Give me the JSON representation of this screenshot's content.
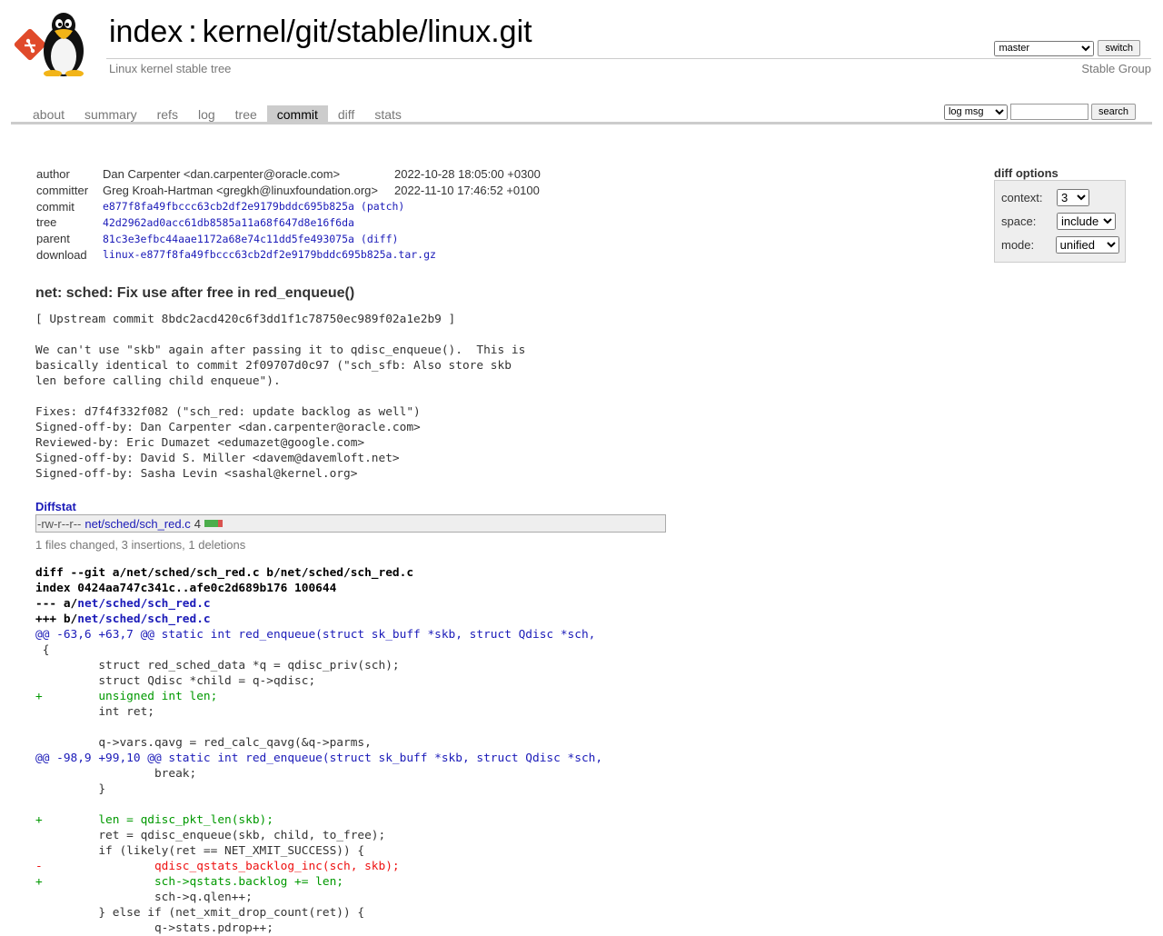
{
  "header": {
    "title_index": "index",
    "title_sep": ":",
    "title_repo": "kernel/git/stable/linux.git",
    "description": "Linux kernel stable tree",
    "owner": "Stable Group",
    "branch_selected": "master",
    "switch_label": "switch"
  },
  "tabs": [
    {
      "label": "about"
    },
    {
      "label": "summary"
    },
    {
      "label": "refs"
    },
    {
      "label": "log"
    },
    {
      "label": "tree"
    },
    {
      "label": "commit",
      "active": true
    },
    {
      "label": "diff"
    },
    {
      "label": "stats"
    }
  ],
  "search": {
    "mode_selected": "log msg",
    "query": "",
    "button_label": "search"
  },
  "diff_options": {
    "title": "diff options",
    "context_label": "context:",
    "context_value": "3",
    "space_label": "space:",
    "space_value": "include",
    "mode_label": "mode:",
    "mode_value": "unified"
  },
  "commit_info": {
    "author_label": "author",
    "author": "Dan Carpenter <dan.carpenter@oracle.com>",
    "author_date": "2022-10-28 18:05:00 +0300",
    "committer_label": "committer",
    "committer": "Greg Kroah-Hartman <gregkh@linuxfoundation.org>",
    "committer_date": "2022-11-10 17:46:52 +0100",
    "commit_label": "commit",
    "commit_hash": "e877f8fa49fbccc63cb2df2e9179bddc695b825a",
    "commit_link": "(patch)",
    "tree_label": "tree",
    "tree_hash": "42d2962ad0acc61db8585a11a68f647d8e16f6da",
    "parent_label": "parent",
    "parent_hash": "81c3e3efbc44aae1172a68e74c11dd5fe493075a",
    "parent_link": "(diff)",
    "download_label": "download",
    "download_file": "linux-e877f8fa49fbccc63cb2df2e9179bddc695b825a.tar.gz"
  },
  "commit": {
    "subject": "net: sched: Fix use after free in red_enqueue()",
    "message": "[ Upstream commit 8bdc2acd420c6f3dd1f1c78750ec989f02a1e2b9 ]\n\nWe can't use \"skb\" again after passing it to qdisc_enqueue().  This is\nbasically identical to commit 2f09707d0c97 (\"sch_sfb: Also store skb\nlen before calling child enqueue\").\n\nFixes: d7f4f332f082 (\"sch_red: update backlog as well\")\nSigned-off-by: Dan Carpenter <dan.carpenter@oracle.com>\nReviewed-by: Eric Dumazet <edumazet@google.com>\nSigned-off-by: David S. Miller <davem@davemloft.net>\nSigned-off-by: Sasha Levin <sashal@kernel.org>"
  },
  "diffstat": {
    "header": "Diffstat",
    "mode": "-rw-r--r--",
    "file": "net/sched/sch_red.c",
    "changes": "4",
    "insertions": 3,
    "deletions": 1,
    "summary": "1 files changed, 3 insertions, 1 deletions"
  },
  "diff": {
    "git_line_prefix": "diff --git a/net/sched/sch_red.c b/net/sched/sch_red.c",
    "index_line": "index 0424aa747c341c..afe0c2d689b176 100644",
    "old_prefix": "--- a/",
    "new_prefix": "+++ b/",
    "path": "net/sched/sch_red.c",
    "lines": [
      {
        "t": "hunk",
        "text": "@@ -63,6 +63,7 @@ static int red_enqueue(struct sk_buff *skb, struct Qdisc *sch,"
      },
      {
        "t": "ctx",
        "text": " {"
      },
      {
        "t": "ctx",
        "text": " \tstruct red_sched_data *q = qdisc_priv(sch);"
      },
      {
        "t": "ctx",
        "text": " \tstruct Qdisc *child = q->qdisc;"
      },
      {
        "t": "add",
        "text": "+\tunsigned int len;"
      },
      {
        "t": "ctx",
        "text": " \tint ret;"
      },
      {
        "t": "ctx",
        "text": " "
      },
      {
        "t": "ctx",
        "text": " \tq->vars.qavg = red_calc_qavg(&q->parms,"
      },
      {
        "t": "hunk",
        "text": "@@ -98,9 +99,10 @@ static int red_enqueue(struct sk_buff *skb, struct Qdisc *sch,"
      },
      {
        "t": "ctx",
        "text": " \t\tbreak;"
      },
      {
        "t": "ctx",
        "text": " \t}"
      },
      {
        "t": "ctx",
        "text": " "
      },
      {
        "t": "add",
        "text": "+\tlen = qdisc_pkt_len(skb);"
      },
      {
        "t": "ctx",
        "text": " \tret = qdisc_enqueue(skb, child, to_free);"
      },
      {
        "t": "ctx",
        "text": " \tif (likely(ret == NET_XMIT_SUCCESS)) {"
      },
      {
        "t": "del",
        "text": "-\t\tqdisc_qstats_backlog_inc(sch, skb);"
      },
      {
        "t": "add",
        "text": "+\t\tsch->qstats.backlog += len;"
      },
      {
        "t": "ctx",
        "text": " \t\tsch->q.qlen++;"
      },
      {
        "t": "ctx",
        "text": " \t} else if (net_xmit_drop_count(ret)) {"
      },
      {
        "t": "ctx",
        "text": " \t\tq->stats.pdrop++;"
      }
    ]
  },
  "colors": {
    "link": "#1a1ab8",
    "addition": "#009900",
    "deletion": "#ee1111",
    "tab_active_bg": "#cccccc"
  },
  "icons": {
    "logo": "cgit-diamond-logo",
    "mascot": "tux-penguin"
  }
}
